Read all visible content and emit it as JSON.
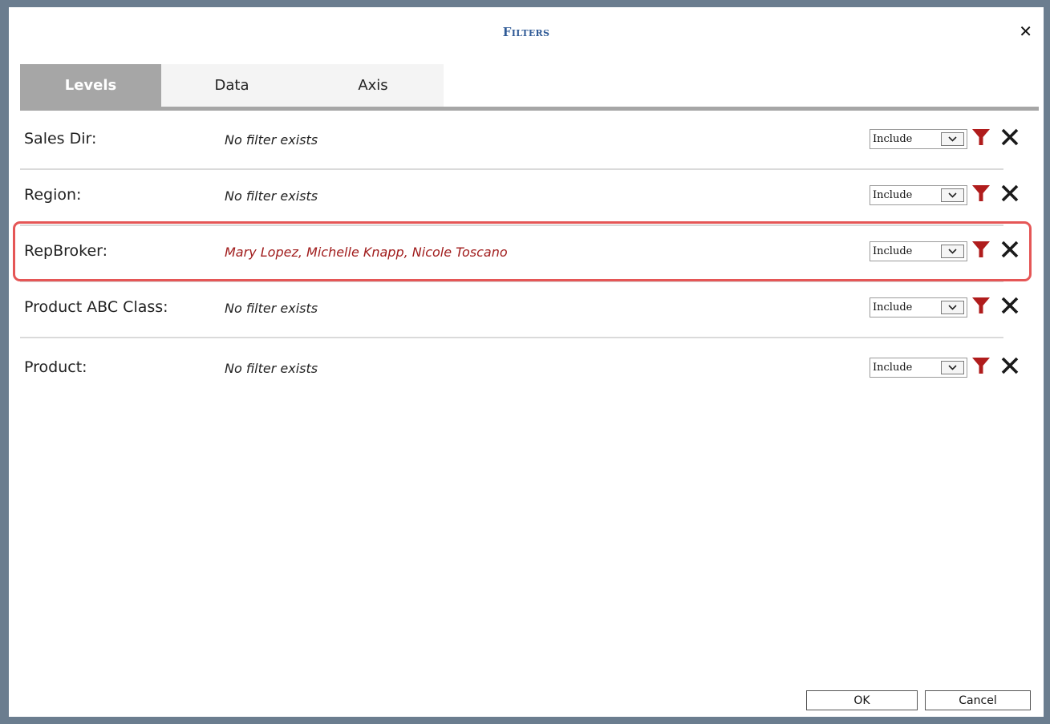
{
  "dialog": {
    "title": "Filters",
    "close_icon": "close-icon"
  },
  "tabs": [
    {
      "label": "Levels",
      "active": true
    },
    {
      "label": "Data",
      "active": false
    },
    {
      "label": "Axis",
      "active": false
    }
  ],
  "filters": [
    {
      "label": "Sales Dir:",
      "value": "No filter exists",
      "mode": "Include",
      "has_filter": false
    },
    {
      "label": "Region:",
      "value": "No filter exists",
      "mode": "Include",
      "has_filter": false
    },
    {
      "label": "RepBroker:",
      "value": "Mary Lopez, Michelle Knapp, Nicole Toscano",
      "mode": "Include",
      "has_filter": true
    },
    {
      "label": "Product ABC Class:",
      "value": "No filter exists",
      "mode": "Include",
      "has_filter": false
    },
    {
      "label": "Product:",
      "value": "No filter exists",
      "mode": "Include",
      "has_filter": false
    }
  ],
  "footer": {
    "ok_label": "OK",
    "cancel_label": "Cancel"
  },
  "colors": {
    "title": "#2f5a96",
    "active_tab": "#a6a6a6",
    "funnel": "#b01c1c",
    "active_filter_text": "#a01b1b",
    "highlight_border": "#e55656"
  },
  "icons": {
    "filter": "funnel-icon",
    "clear": "clear-x-icon",
    "dropdown": "chevron-down-icon"
  }
}
